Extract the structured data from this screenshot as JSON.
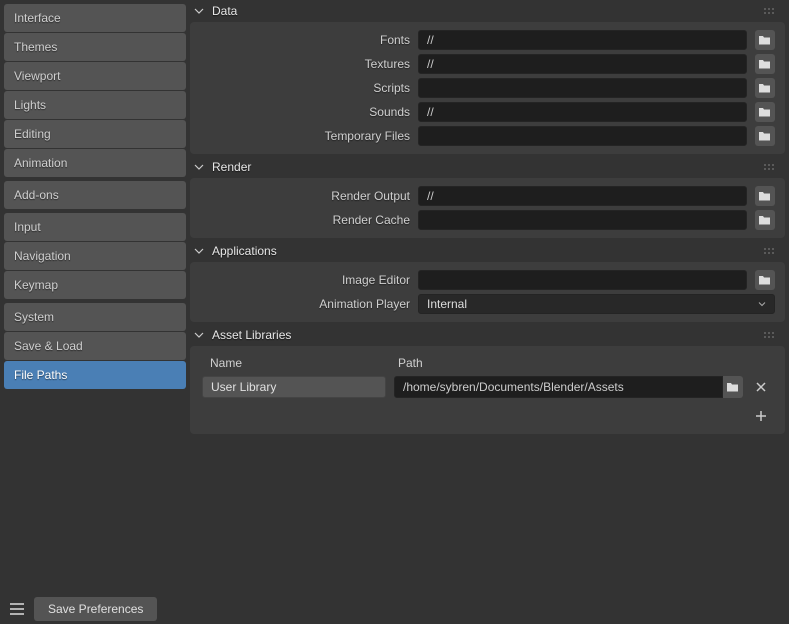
{
  "sidebar": {
    "group1": [
      "Interface",
      "Themes",
      "Viewport",
      "Lights",
      "Editing",
      "Animation"
    ],
    "group2": [
      "Add-ons"
    ],
    "group3": [
      "Input",
      "Navigation",
      "Keymap"
    ],
    "group4": [
      "System",
      "Save & Load",
      "File Paths"
    ]
  },
  "active_sidebar_item": "File Paths",
  "panels": {
    "data": {
      "title": "Data",
      "rows": {
        "fonts": {
          "label": "Fonts",
          "value": "//"
        },
        "textures": {
          "label": "Textures",
          "value": "//"
        },
        "scripts": {
          "label": "Scripts",
          "value": ""
        },
        "sounds": {
          "label": "Sounds",
          "value": "//"
        },
        "temp": {
          "label": "Temporary Files",
          "value": ""
        }
      }
    },
    "render": {
      "title": "Render",
      "rows": {
        "output": {
          "label": "Render Output",
          "value": "//"
        },
        "cache": {
          "label": "Render Cache",
          "value": ""
        }
      }
    },
    "applications": {
      "title": "Applications",
      "rows": {
        "image_editor": {
          "label": "Image Editor",
          "value": ""
        },
        "anim_player": {
          "label": "Animation Player",
          "value": "Internal"
        }
      }
    },
    "asset_libraries": {
      "title": "Asset Libraries",
      "headers": {
        "name": "Name",
        "path": "Path"
      },
      "items": [
        {
          "name": "User Library",
          "path": "/home/sybren/Documents/Blender/Assets"
        }
      ]
    }
  },
  "footer": {
    "save_label": "Save Preferences"
  }
}
